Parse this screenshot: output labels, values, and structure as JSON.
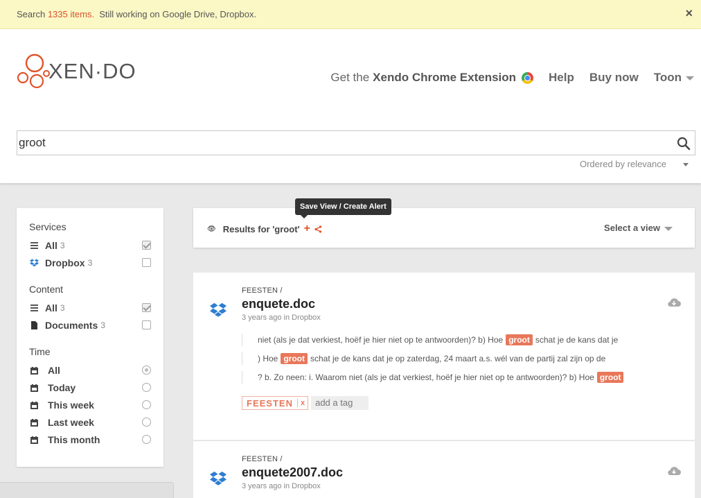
{
  "notice": {
    "prefix": "Search ",
    "items": "1335 items.",
    "suffix": "  Still working on Google Drive, Dropbox.",
    "close": "×"
  },
  "logo": {
    "word": "XEN·DO"
  },
  "nav": {
    "ext_prefix": "Get the",
    "ext_bold": "Xendo Chrome Extension",
    "help": "Help",
    "buy": "Buy now",
    "user": "Toon"
  },
  "search": {
    "value": "groot",
    "order": "Ordered by relevance"
  },
  "sidebar": {
    "services_title": "Services",
    "services": [
      {
        "label": "All",
        "count": "3",
        "icon": "list-icon",
        "checked": true
      },
      {
        "label": "Dropbox",
        "count": "3",
        "icon": "dropbox-icon",
        "checked": false
      }
    ],
    "content_title": "Content",
    "content": [
      {
        "label": "All",
        "count": "3",
        "icon": "list-icon",
        "checked": true
      },
      {
        "label": "Documents",
        "count": "3",
        "icon": "document-icon",
        "checked": false
      }
    ],
    "time_title": "Time",
    "time": [
      {
        "label": "All",
        "icon": "calendar-icon",
        "selected": true
      },
      {
        "label": "Today",
        "icon": "calendar-icon",
        "selected": false
      },
      {
        "label": "This week",
        "icon": "calendar-icon",
        "selected": false
      },
      {
        "label": "Last week",
        "icon": "calendar-icon",
        "selected": false
      },
      {
        "label": "This month",
        "icon": "calendar-icon",
        "selected": false
      }
    ]
  },
  "tooltip": "Save View / Create Alert",
  "results": {
    "label": "Results for 'groot'",
    "plus": "+",
    "select_view": "Select a view"
  },
  "cards": [
    {
      "folder": "FEESTEN /",
      "title": "enquete.doc",
      "meta": "3 years ago in Dropbox",
      "snippets": [
        {
          "before": "niet (als je dat verkiest, hoëf je hier niet op te antwoorden)? b) Hoe",
          "hl": "groot",
          "after": "schat je de kans dat je"
        },
        {
          "before": ") Hoe",
          "hl": "groot",
          "after": "schat je de kans dat je op zaterdag, 24 maart a.s. wél van de partij zal zijn op de"
        },
        {
          "before": "? b. Zo neen: i. Waarom niet (als je dat verkiest, hoëf je hier niet op te antwoorden)? b) Hoe",
          "hl": "groot",
          "after": ""
        }
      ],
      "tag": "FEESTEN",
      "tag_remove": "x",
      "add_tag": "add a tag"
    },
    {
      "folder": "FEESTEN /",
      "title": "enquete2007.doc",
      "meta": "3 years ago in Dropbox"
    }
  ],
  "colors": {
    "accent": "#e0552b",
    "highlight": "#e8775a",
    "notice_bg": "#fbf8c6",
    "page_bg": "#e9e9e9"
  }
}
